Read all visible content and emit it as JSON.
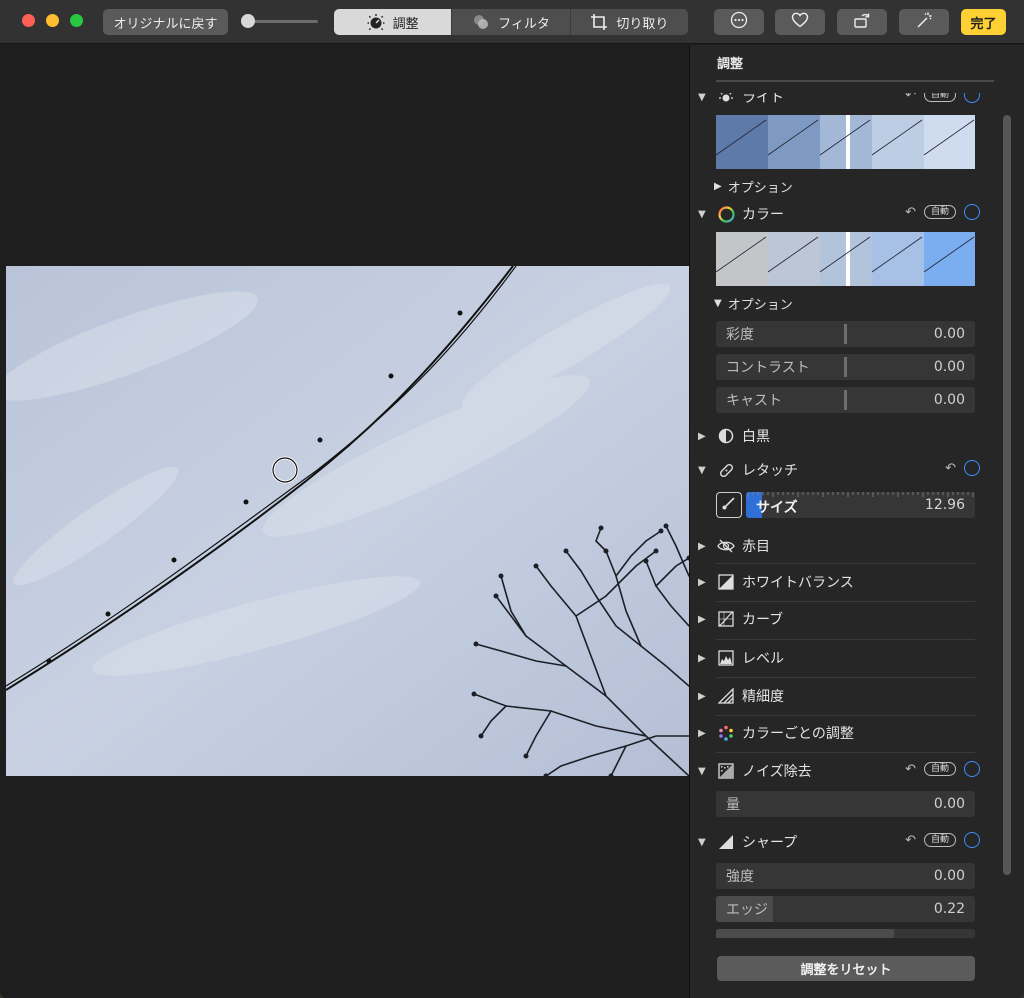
{
  "toolbar": {
    "revert_label": "オリジナルに戻す",
    "tabs": [
      {
        "label": "調整",
        "icon": "adjust-dial-icon",
        "active": true
      },
      {
        "label": "フィルタ",
        "icon": "filter-circles-icon",
        "active": false
      },
      {
        "label": "切り取り",
        "icon": "crop-icon",
        "active": false
      }
    ],
    "actions": [
      {
        "icon": "more-ellipsis-icon"
      },
      {
        "icon": "heart-icon"
      },
      {
        "icon": "rotate-icon"
      },
      {
        "icon": "magic-wand-icon"
      }
    ],
    "done_label": "完了",
    "zoom_level": 0.0
  },
  "panel": {
    "title": "調整",
    "sections": {
      "light": {
        "label": "ライト",
        "auto": "自動"
      },
      "light_options": "オプション",
      "color": {
        "label": "カラー",
        "auto": "自動"
      },
      "color_options": "オプション",
      "color_fields": [
        {
          "label": "彩度",
          "value": "0.00"
        },
        {
          "label": "コントラスト",
          "value": "0.00"
        },
        {
          "label": "キャスト",
          "value": "0.00"
        }
      ],
      "bw": {
        "label": "白黒"
      },
      "retouch": {
        "label": "レタッチ",
        "size_label": "サイズ",
        "size_value": "12.96",
        "size_fraction": 0.07
      },
      "redeye": {
        "label": "赤目"
      },
      "white_balance": {
        "label": "ホワイトバランス"
      },
      "curves": {
        "label": "カーブ"
      },
      "levels": {
        "label": "レベル"
      },
      "definition": {
        "label": "精細度"
      },
      "selective_color": {
        "label": "カラーごとの調整"
      },
      "noise": {
        "label": "ノイズ除去",
        "auto": "自動",
        "amount_label": "量",
        "amount_value": "0.00"
      },
      "sharpen": {
        "label": "シャープ",
        "auto": "自動",
        "intensity_label": "強度",
        "intensity_value": "0.00",
        "edges_label": "エッジ",
        "edges_value": "0.22",
        "edges_fraction": 0.22
      }
    },
    "reset_label": "調整をリセット"
  },
  "colors": {
    "accent_blue": "#3d8dff",
    "done_yellow": "#fed034",
    "retouch_fill": "#2f6fd6"
  }
}
